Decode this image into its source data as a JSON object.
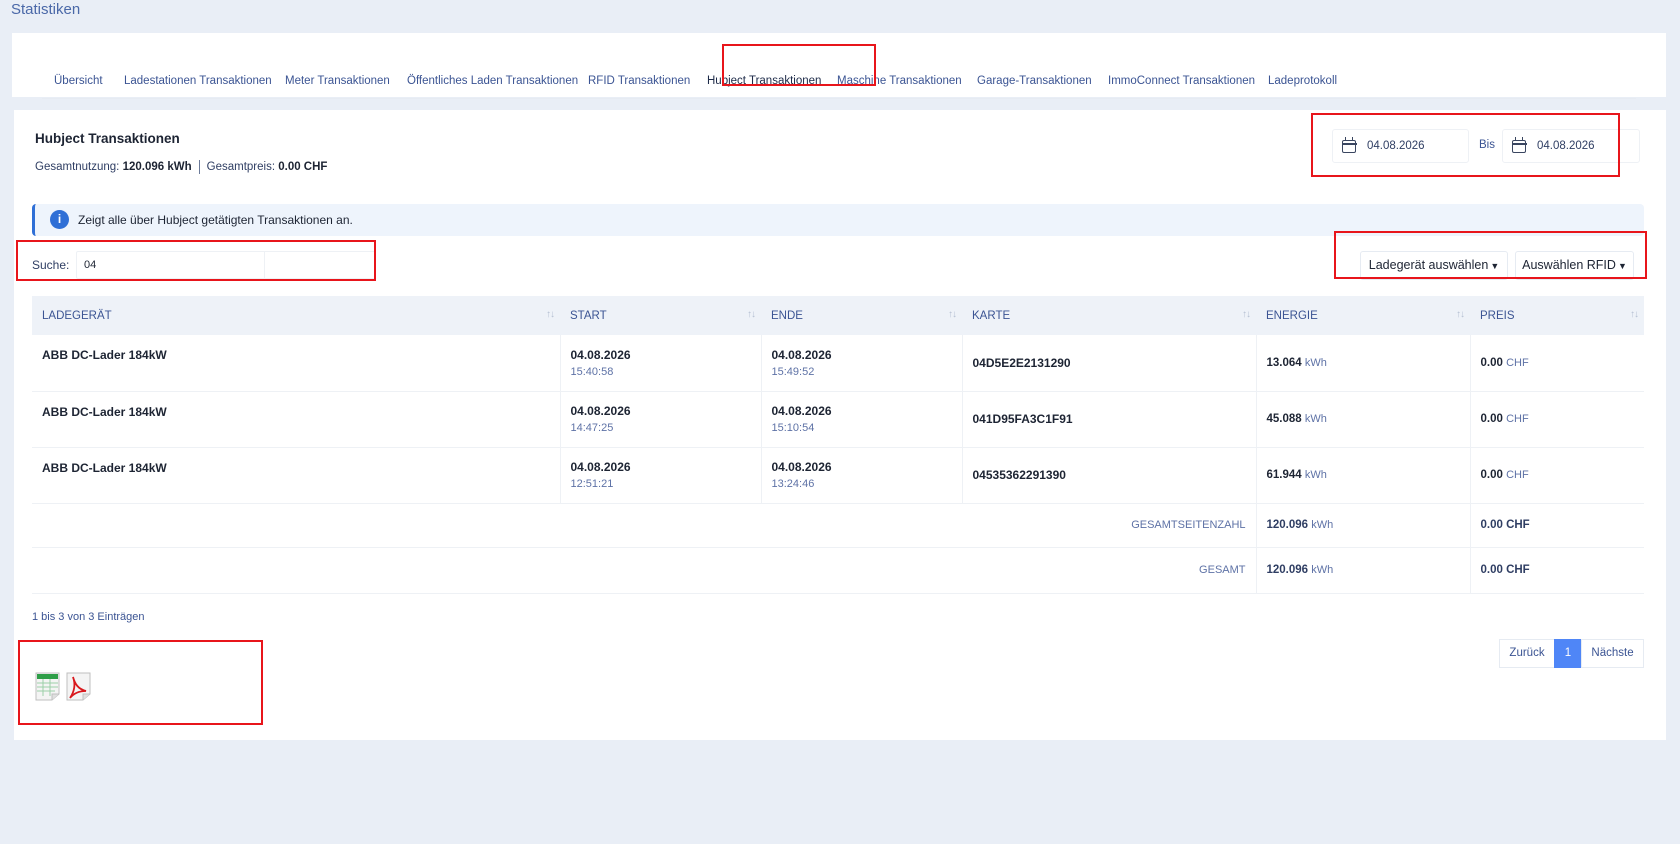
{
  "page": {
    "title": "Statistiken"
  },
  "tabs": [
    "Übersicht",
    "Ladestationen Transaktionen",
    "Meter Transaktionen",
    "Öffentliches Laden Transaktionen",
    "RFID Transaktionen",
    "Hubject Transaktionen",
    "Maschine Transaktionen",
    "Garage-Transaktionen",
    "ImmoConnect Transaktionen",
    "Ladeprotokoll"
  ],
  "active_tab": "Hubject Transaktionen",
  "section": {
    "title": "Hubject Transaktionen",
    "usage_label": "Gesamtnutzung:",
    "usage_value": "120.096 kWh",
    "price_label": "Gesamtpreis:",
    "price_value": "0.00 CHF"
  },
  "date_range": {
    "from": "04.08.2026",
    "separator": "Bis",
    "to": "04.08.2026"
  },
  "info": {
    "icon": "info-icon",
    "text": "Zeigt alle über Hubject getätigten Transaktionen an."
  },
  "search": {
    "label": "Suche:",
    "value": "04"
  },
  "filters": {
    "charger": "Ladegerät auswählen",
    "rfid": "Auswählen RFID"
  },
  "table": {
    "headers": [
      "LADEGERÄT",
      "START",
      "ENDE",
      "KARTE",
      "ENERGIE",
      "PREIS"
    ],
    "rows": [
      {
        "charger": "ABB DC-Lader 184kW",
        "start_date": "04.08.2026",
        "start_time": "15:40:58",
        "end_date": "04.08.2026",
        "end_time": "15:49:52",
        "card": "04D5E2E2131290",
        "energy": "13.064",
        "energy_unit": "kWh",
        "price": "0.00",
        "price_unit": "CHF"
      },
      {
        "charger": "ABB DC-Lader 184kW",
        "start_date": "04.08.2026",
        "start_time": "14:47:25",
        "end_date": "04.08.2026",
        "end_time": "15:10:54",
        "card": "041D95FA3C1F91",
        "energy": "45.088",
        "energy_unit": "kWh",
        "price": "0.00",
        "price_unit": "CHF"
      },
      {
        "charger": "ABB DC-Lader 184kW",
        "start_date": "04.08.2026",
        "start_time": "12:51:21",
        "end_date": "04.08.2026",
        "end_time": "13:24:46",
        "card": "04535362291390",
        "energy": "61.944",
        "energy_unit": "kWh",
        "price": "0.00",
        "price_unit": "CHF"
      }
    ],
    "page_total": {
      "label": "GESAMTSEITENZAHL",
      "energy": "120.096",
      "energy_unit": "kWh",
      "price": "0.00 CHF"
    },
    "grand_total": {
      "label": "GESAMT",
      "energy": "120.096",
      "energy_unit": "kWh",
      "price": "0.00 CHF"
    }
  },
  "entries_info": "1 bis 3 von 3 Einträgen",
  "pagination": {
    "prev": "Zurück",
    "current": "1",
    "next": "Nächste"
  },
  "export": {
    "excel_icon": "excel-export-icon",
    "pdf_icon": "pdf-export-icon"
  },
  "colors": {
    "accent": "#4f86f7",
    "highlight": "#e8151b",
    "info": "#2f6fd6"
  }
}
